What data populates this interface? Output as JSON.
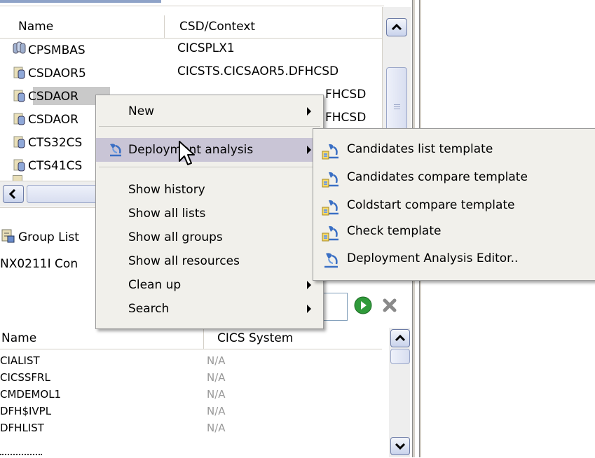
{
  "top_table": {
    "headers": {
      "name": "Name",
      "context": "CSD/Context"
    },
    "rows": [
      {
        "name": "CPSMBAS",
        "context": "CICSPLX1"
      },
      {
        "name": "CSDAOR5",
        "context": "CICSTS.CICSAOR5.DFHCSD"
      },
      {
        "name": "CSDAOR",
        "context": "FHCSD"
      },
      {
        "name": "CSDAOR",
        "context": "FHCSD"
      },
      {
        "name": "CTS32CS",
        "context": ""
      },
      {
        "name": "CTS41CS",
        "context": ""
      }
    ]
  },
  "view_tab": {
    "label": "Group List"
  },
  "message": "NX0211I Con",
  "toolbar": {
    "go_icon": "go-icon",
    "clear_icon": "clear-icon"
  },
  "bottom_table": {
    "headers": {
      "name": "Name",
      "system": "CICS System"
    },
    "rows": [
      {
        "name": "CIALIST",
        "system": "N/A"
      },
      {
        "name": "CICSSFRL",
        "system": "N/A"
      },
      {
        "name": "CMDEMOL1",
        "system": "N/A"
      },
      {
        "name": "DFH$IVPL",
        "system": "N/A"
      },
      {
        "name": "DFHLIST",
        "system": "N/A"
      }
    ]
  },
  "context_menu": {
    "items": [
      {
        "label": "New",
        "submenu": true
      },
      {
        "label": "Deployment analysis",
        "submenu": true,
        "highlighted": true
      },
      {
        "label": "Show history"
      },
      {
        "label": "Show all lists"
      },
      {
        "label": "Show all groups"
      },
      {
        "label": "Show all resources"
      },
      {
        "label": "Clean up",
        "submenu": true
      },
      {
        "label": "Search",
        "submenu": true
      }
    ]
  },
  "submenu": {
    "items": [
      {
        "label": "Candidates list template"
      },
      {
        "label": "Candidates compare template"
      },
      {
        "label": "Coldstart compare template"
      },
      {
        "label": "Check template"
      },
      {
        "label": "Deployment Analysis Editor.."
      }
    ]
  },
  "colors": {
    "menu_bg": "#f1f0eb",
    "highlight": "#c9c5d6",
    "selection": "#c9c9c9",
    "go": "#2f9a3a"
  }
}
